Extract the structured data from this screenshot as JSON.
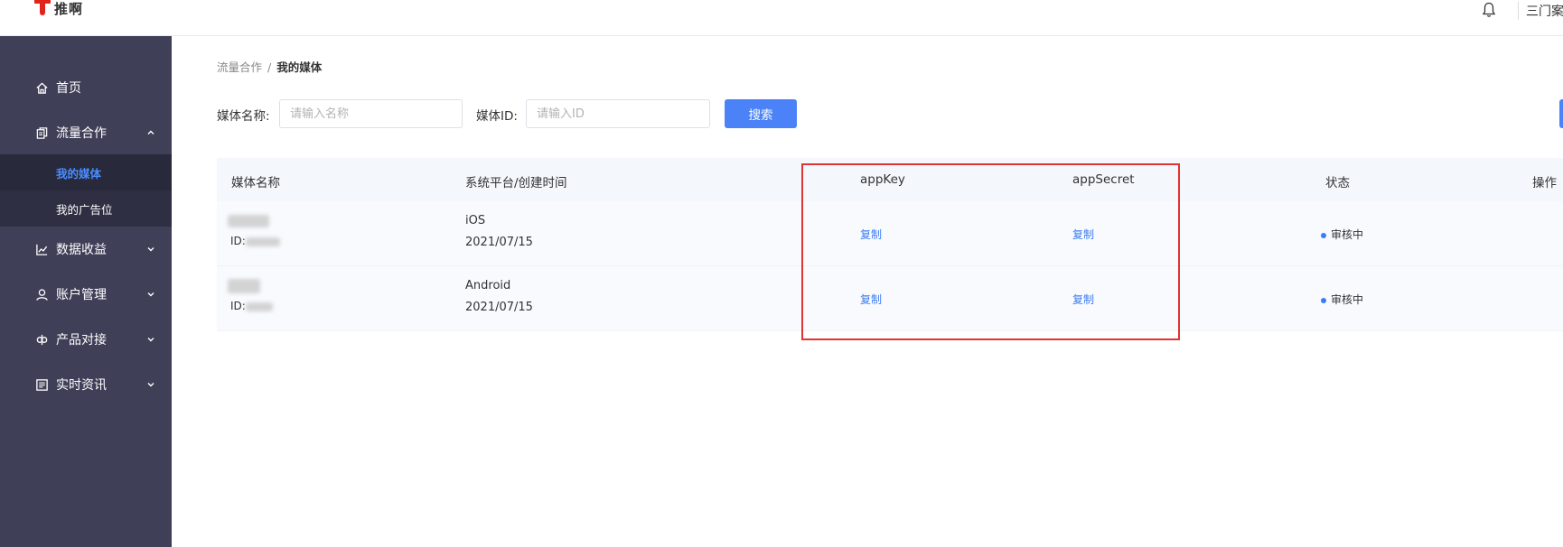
{
  "header": {
    "logo_text": "推啊",
    "user_text": "三门案"
  },
  "sidebar": {
    "items": [
      {
        "label": "首页",
        "icon": "home-icon"
      },
      {
        "label": "流量合作",
        "icon": "document-icon"
      },
      {
        "label": "数据收益",
        "icon": "chart-icon"
      },
      {
        "label": "账户管理",
        "icon": "user-icon"
      },
      {
        "label": "产品对接",
        "icon": "link-icon"
      },
      {
        "label": "实时资讯",
        "icon": "news-icon"
      }
    ],
    "sub_items": [
      {
        "label": "我的媒体",
        "active": true
      },
      {
        "label": "我的广告位",
        "active": false
      }
    ]
  },
  "breadcrumb": {
    "parent": "流量合作",
    "separator": "/",
    "current": "我的媒体"
  },
  "filters": {
    "name_label": "媒体名称:",
    "name_placeholder": "请输入名称",
    "id_label": "媒体ID:",
    "id_placeholder": "请输入ID",
    "search_label": "搜索"
  },
  "table": {
    "columns": [
      "媒体名称",
      "系统平台/创建时间",
      "appKey",
      "appSecret",
      "状态",
      "操作"
    ],
    "rows": [
      {
        "id_prefix": "ID:",
        "platform": "iOS",
        "date": "2021/07/15",
        "app_key": "复制",
        "app_secret": "复制",
        "status": "审核中"
      },
      {
        "id_prefix": "ID:",
        "platform": "Android",
        "date": "2021/07/15",
        "app_key": "复制",
        "app_secret": "复制",
        "status": "审核中"
      }
    ]
  },
  "colors": {
    "sidebar_bg": "#3f3f58",
    "submenu_bg": "#2f2f44",
    "accent": "#4b82f7",
    "highlight": "#e03333"
  }
}
